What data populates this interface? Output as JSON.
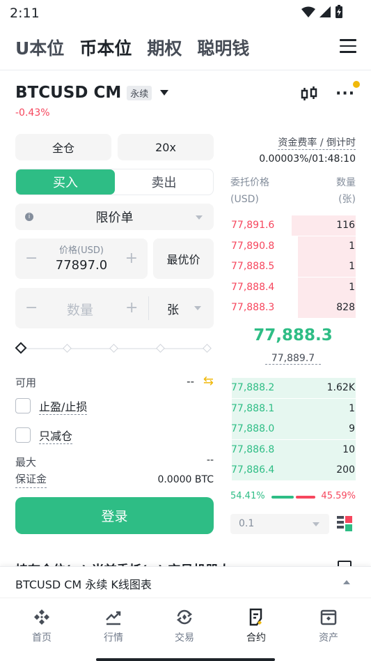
{
  "status_bar": {
    "time": "2:11"
  },
  "top_tabs": [
    "U本位",
    "币本位",
    "期权",
    "聪明钱"
  ],
  "active_tab_index": 1,
  "symbol": {
    "name": "BTCUSD CM",
    "badge": "永续",
    "change": "-0.43%"
  },
  "order_form": {
    "margin_mode": "全仓",
    "leverage": "20x",
    "buy_label": "买入",
    "sell_label": "卖出",
    "order_type": "限价单",
    "price_label": "价格(USD)",
    "price_value": "77897.0",
    "best_price": "最优价",
    "quantity_placeholder": "数量",
    "unit": "张",
    "slider_percent": 0,
    "available_label": "可用",
    "available_value": "--",
    "tpsl_label": "止盈/止损",
    "reduce_only_label": "只减仓",
    "max_label_1": "最大",
    "max_label_2": "保证金",
    "max_value": "--",
    "margin_value": "0.0000 BTC",
    "login": "登录"
  },
  "funding": {
    "label": "资金费率 / 倒计时",
    "value": "0.00003%/01:48:10"
  },
  "orderbook": {
    "price_header_1": "委托价格",
    "price_header_2": "(USD)",
    "qty_header_1": "数量",
    "qty_header_2": "(张)",
    "asks": [
      {
        "price": "77,891.6",
        "qty": "116",
        "depth": 0.51
      },
      {
        "price": "77,890.8",
        "qty": "1",
        "depth": 0.46
      },
      {
        "price": "77,888.5",
        "qty": "1",
        "depth": 0.46
      },
      {
        "price": "77,888.4",
        "qty": "1",
        "depth": 0.46
      },
      {
        "price": "77,888.3",
        "qty": "828",
        "depth": 0.46
      }
    ],
    "mid_price": "77,888.3",
    "mark_price": "77,889.7",
    "bids": [
      {
        "price": "77,888.2",
        "qty": "1.62K",
        "depth": 0.99
      },
      {
        "price": "77,888.1",
        "qty": "1",
        "depth": 0.99
      },
      {
        "price": "77,888.0",
        "qty": "9",
        "depth": 0.99
      },
      {
        "price": "77,886.8",
        "qty": "10",
        "depth": 0.99
      },
      {
        "price": "77,886.4",
        "qty": "200",
        "depth": 0.99
      }
    ],
    "buy_ratio": "54.41%",
    "sell_ratio": "45.59%",
    "precision": "0.1"
  },
  "peek_text": "持有仓位(--)  当前委托(--)  交易机器人",
  "kline_bar": {
    "label": "BTCUSD CM 永续 K线图表"
  },
  "bottom_nav": [
    "首页",
    "行情",
    "交易",
    "合约",
    "资产"
  ],
  "active_nav_index": 3,
  "colors": {
    "green": "#2ebd85",
    "red": "#f6465d",
    "yellow": "#f0b90b"
  }
}
